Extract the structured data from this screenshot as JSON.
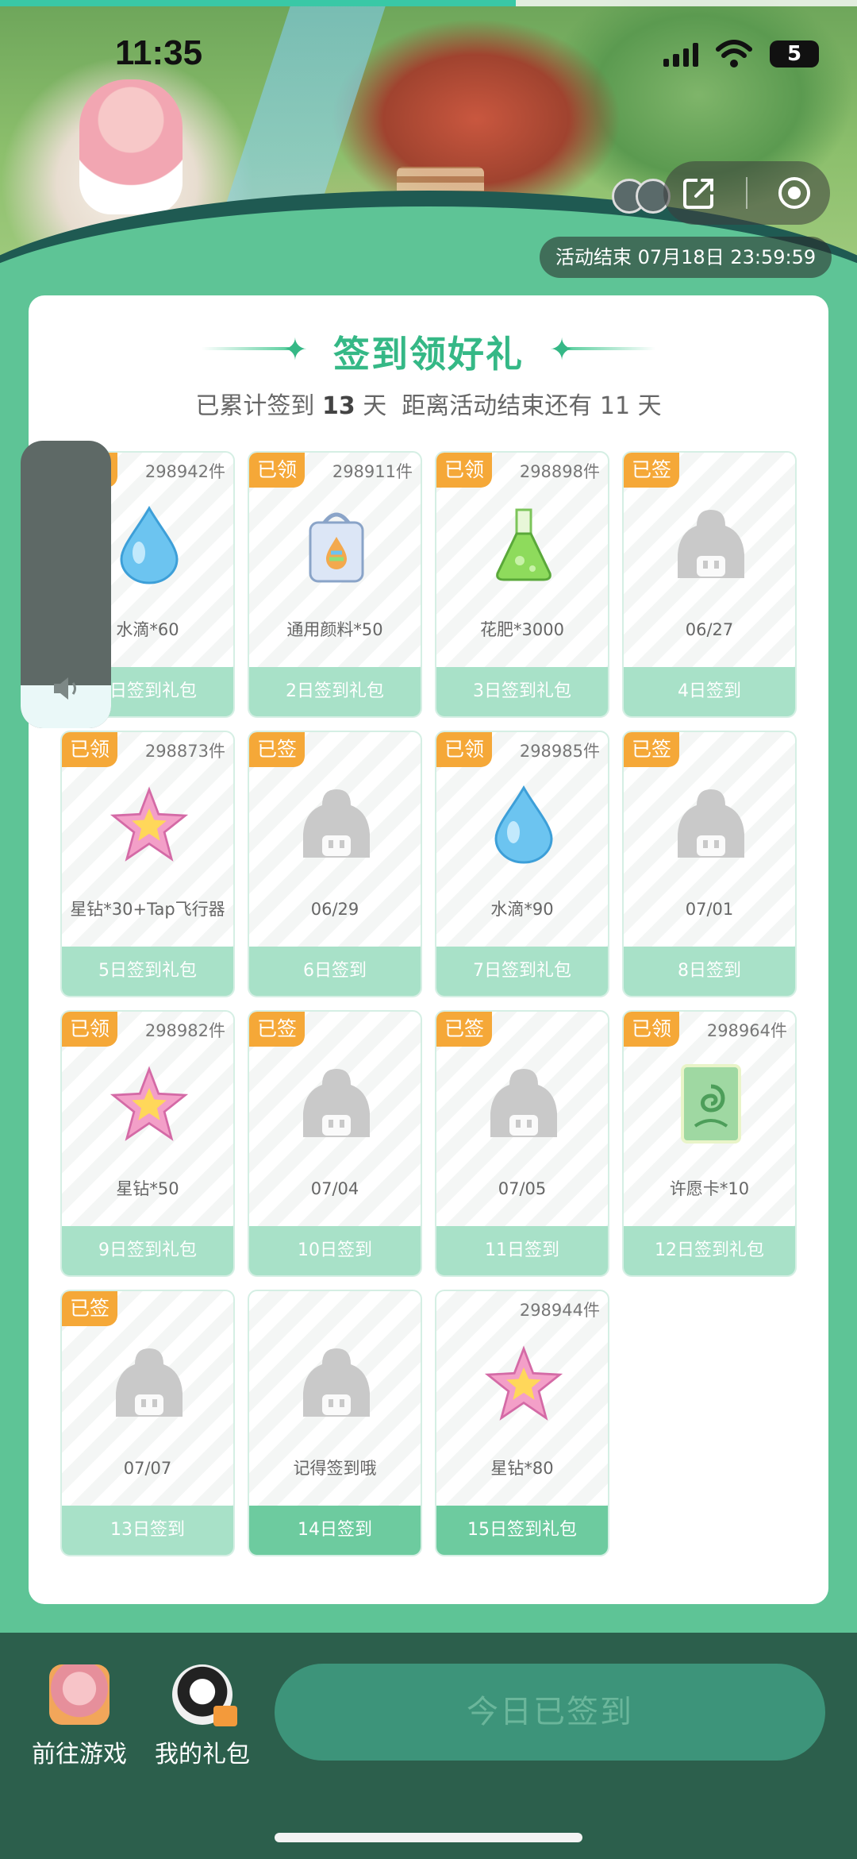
{
  "status_bar": {
    "time": "11:35",
    "battery": "5"
  },
  "banner": {
    "end_time": "活动结束 07月18日 23:59:59"
  },
  "card": {
    "title": "签到领好礼",
    "subtitle_prefix": "已累计签到",
    "days_signed": "13",
    "subtitle_mid": "天  距离活动结束还有",
    "days_left": "11",
    "subtitle_suffix": "天"
  },
  "cells": [
    {
      "badge": "已领",
      "count": "298942件",
      "icon": "water-drop",
      "name": "水滴*60",
      "footer": "1日签到礼包"
    },
    {
      "badge": "已领",
      "count": "298911件",
      "icon": "paint-bucket",
      "name": "通用颜料*50",
      "footer": "2日签到礼包"
    },
    {
      "badge": "已领",
      "count": "298898件",
      "icon": "fertilizer-flask",
      "name": "花肥*3000",
      "footer": "3日签到礼包"
    },
    {
      "badge": "已签",
      "count": "",
      "icon": "placeholder",
      "name": "06/27",
      "footer": "4日签到"
    },
    {
      "badge": "已领",
      "count": "298873件",
      "icon": "star",
      "name": "星钻*30+Tap飞行器",
      "footer": "5日签到礼包"
    },
    {
      "badge": "已签",
      "count": "",
      "icon": "placeholder",
      "name": "06/29",
      "footer": "6日签到"
    },
    {
      "badge": "已领",
      "count": "298985件",
      "icon": "water-drop",
      "name": "水滴*90",
      "footer": "7日签到礼包"
    },
    {
      "badge": "已签",
      "count": "",
      "icon": "placeholder",
      "name": "07/01",
      "footer": "8日签到"
    },
    {
      "badge": "已领",
      "count": "298982件",
      "icon": "star",
      "name": "星钻*50",
      "footer": "9日签到礼包"
    },
    {
      "badge": "已签",
      "count": "",
      "icon": "placeholder",
      "name": "07/04",
      "footer": "10日签到"
    },
    {
      "badge": "已签",
      "count": "",
      "icon": "placeholder",
      "name": "07/05",
      "footer": "11日签到"
    },
    {
      "badge": "已领",
      "count": "298964件",
      "icon": "wish-card",
      "name": "许愿卡*10",
      "footer": "12日签到礼包"
    },
    {
      "badge": "已签",
      "count": "",
      "icon": "placeholder",
      "name": "07/07",
      "footer": "13日签到"
    },
    {
      "badge": "",
      "count": "",
      "icon": "placeholder",
      "name": "记得签到哦",
      "footer": "14日签到",
      "active": true
    },
    {
      "badge": "",
      "count": "298944件",
      "icon": "star",
      "name": "星钻*80",
      "footer": "15日签到礼包",
      "active": true
    }
  ],
  "bottom_bar": {
    "game_label": "前往游戏",
    "gift_label": "我的礼包",
    "checkin_button": "今日已签到"
  }
}
